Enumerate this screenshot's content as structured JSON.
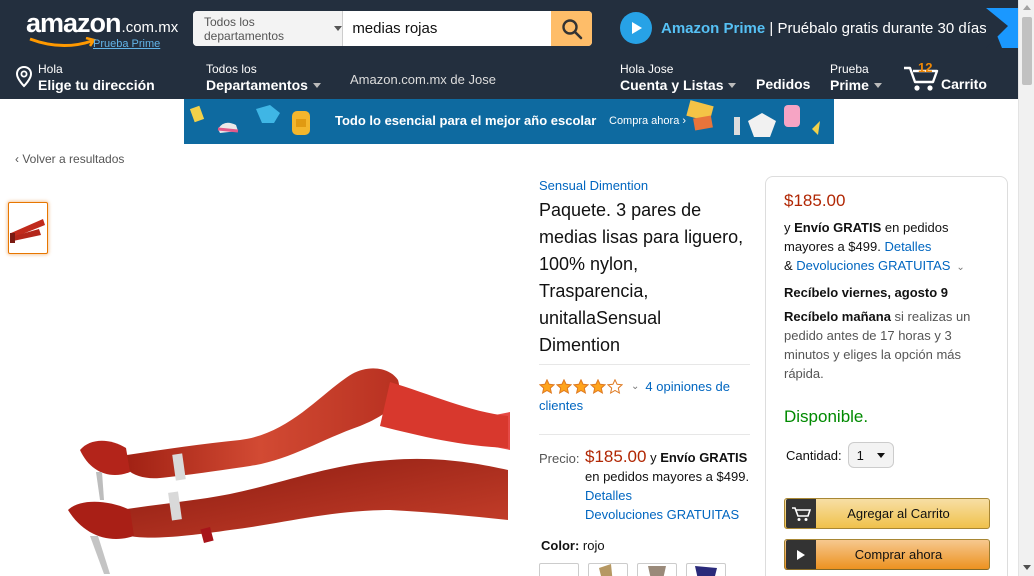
{
  "colors": {
    "nav": "#232f3e",
    "accent": "#febd69",
    "price": "#b12704",
    "link": "#0066c0",
    "stock": "#008a00"
  },
  "header": {
    "logo_text": "amazon",
    "logo_tld": ".com.mx",
    "logo_prime": "Prueba Prime",
    "search": {
      "department": "Todos los departamentos",
      "value": "medias rojas",
      "icon": "search-icon"
    },
    "prime_promo": {
      "brand": "Amazon Prime",
      "separator": " | ",
      "text": "Pruébalo gratis durante 30 días"
    }
  },
  "nav": {
    "location": {
      "line1": "Hola",
      "line2": "Elige tu dirección",
      "icon": "location-pin-icon"
    },
    "departments": {
      "line1": "Todos los",
      "line2": "Departamentos"
    },
    "store_link": "Amazon.com.mx de Jose",
    "account": {
      "line1": "Hola Jose",
      "line2": "Cuenta y Listas"
    },
    "orders": "Pedidos",
    "prime": {
      "line1": "Prueba",
      "line2": "Prime"
    },
    "cart": {
      "count": "12",
      "label": "Carrito",
      "icon": "cart-icon"
    }
  },
  "banner": {
    "text": "Todo lo esencial para el mejor año escolar",
    "cta": "Compra ahora ›"
  },
  "back_link": "‹  Volver a resultados",
  "product": {
    "brand": "Sensual Dimention",
    "title": "Paquete. 3 pares de medias lisas para liguero, 100% nylon, Trasparencia, unitallaSensual Dimention",
    "rating": 4,
    "rating_max": 5,
    "reviews": "4 opiniones de clientes",
    "price_label": "Precio:",
    "price": "$185.00",
    "shipping_conj": " y ",
    "shipping_free": "Envío GRATIS",
    "shipping_rest": " en pedidos mayores a $499.",
    "details": "Detalles",
    "returns": "Devoluciones GRATUITAS",
    "color_label": "Color:",
    "color_value": "rojo"
  },
  "buybox": {
    "price": "$185.00",
    "ship_conj": "y ",
    "ship_free": "Envío GRATIS",
    "ship_rest": " en pedidos mayores a $499. ",
    "details": "Detalles",
    "returns_prefix": "& ",
    "returns": "Devoluciones GRATUITAS",
    "arrival": "Recíbelo viernes, agosto 9",
    "fast_bold": "Recíbelo mañana",
    "fast_rest": " si realizas un pedido antes de 17 horas y 3 minutos y eliges la opción más rápida.",
    "stock": "Disponible.",
    "qty_label": "Cantidad:",
    "qty_value": "1",
    "add_to_cart": "Agregar al Carrito",
    "buy_now": "Comprar ahora"
  }
}
